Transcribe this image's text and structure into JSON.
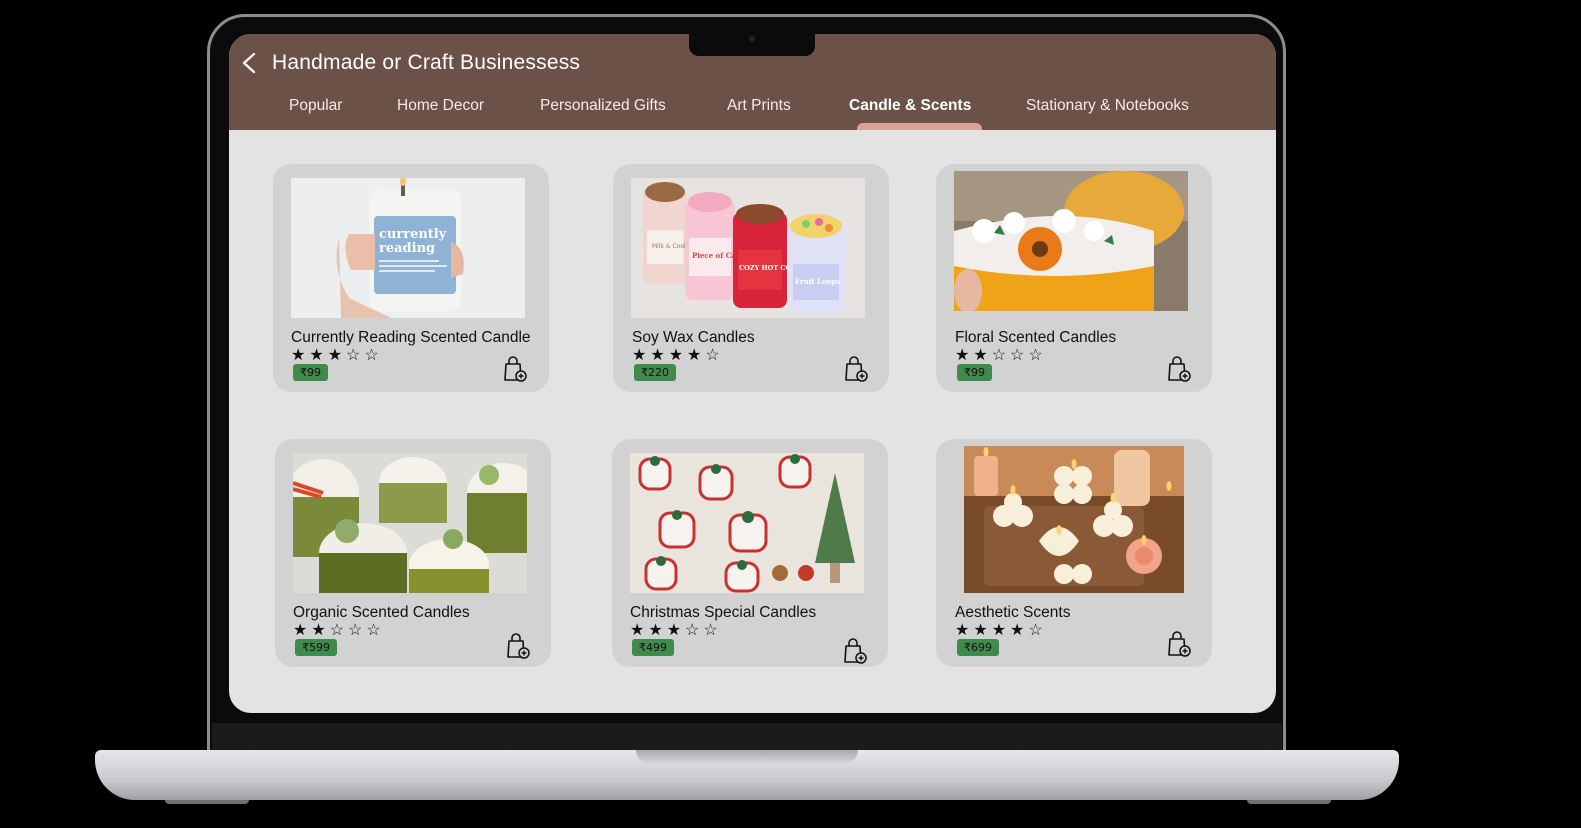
{
  "header": {
    "title": "Handmade or Craft Businessess"
  },
  "tabs": [
    {
      "label": "Popular"
    },
    {
      "label": "Home Decor"
    },
    {
      "label": "Personalized Gifts"
    },
    {
      "label": "Art Prints"
    },
    {
      "label": "Candle & Scents"
    },
    {
      "label": "Stationary & Notebooks"
    }
  ],
  "active_tab": "Candle & Scents",
  "products": [
    {
      "title": "Currently Reading Scented Candle",
      "rating": 3,
      "rating_max": 5,
      "price": "₹99"
    },
    {
      "title": "Soy Wax Candles",
      "rating": 4,
      "rating_max": 5,
      "price": "₹220"
    },
    {
      "title": "Floral Scented Candles",
      "rating": 2,
      "rating_max": 5,
      "price": "₹99"
    },
    {
      "title": "Organic Scented Candles",
      "rating": 2,
      "rating_max": 5,
      "price": "₹599"
    },
    {
      "title": "Christmas Special Candles",
      "rating": 3,
      "rating_max": 5,
      "price": "₹499"
    },
    {
      "title": "Aesthetic Scents",
      "rating": 4,
      "rating_max": 5,
      "price": "₹699"
    }
  ],
  "product_images": [
    {
      "label_line1": "currently",
      "label_line2": "reading"
    },
    {
      "jar_labels": [
        "Milk & Cookies",
        "Piece of Cake",
        "COZY HOT COCOA",
        "Fruit Loops"
      ]
    },
    {},
    {},
    {},
    {}
  ],
  "colors": {
    "header_bg": "#6b5148",
    "tab_indicator": "#d9a39c",
    "price_badge": "#3f8a4c",
    "card_bg": "#d2d2d2",
    "screen_bg": "#e3e3e3"
  },
  "icons": {
    "back": "chevron-left-icon",
    "add_to_bag": "shopping-bag-plus-icon"
  }
}
